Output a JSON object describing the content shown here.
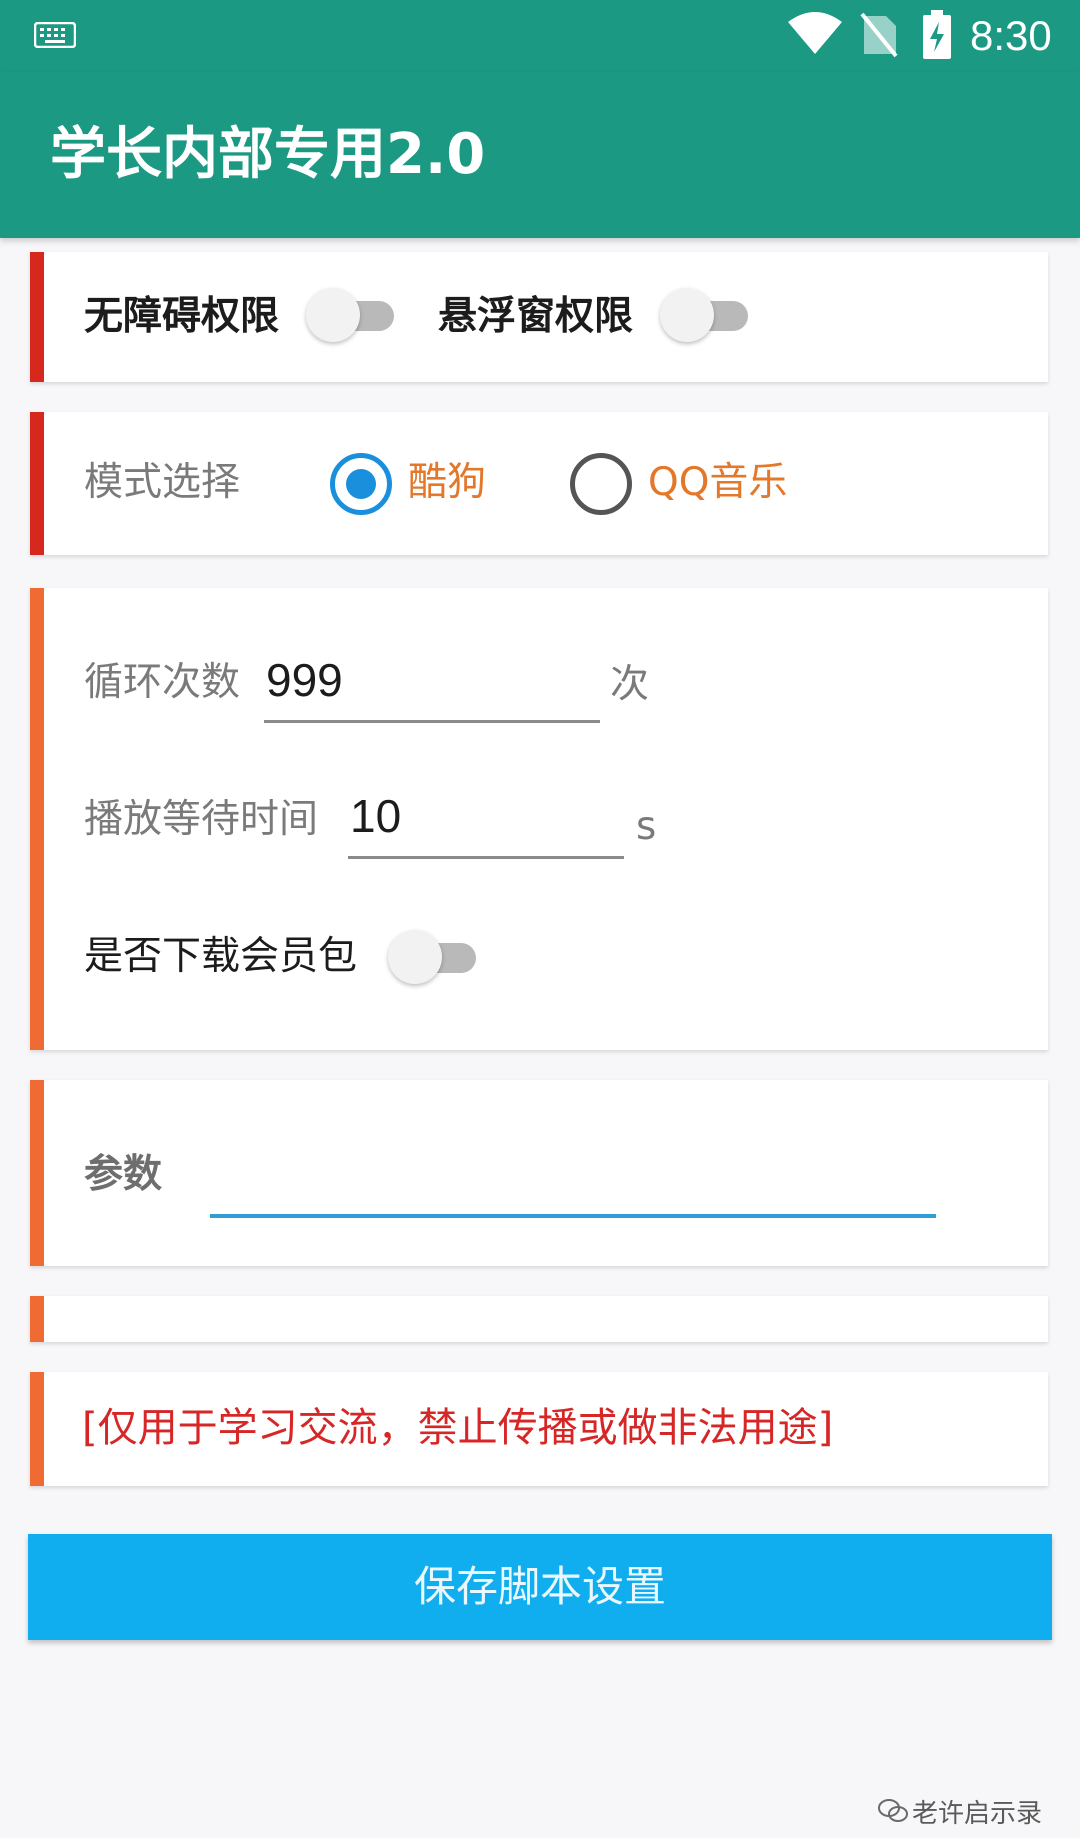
{
  "status_bar": {
    "time": "8:30",
    "icons": [
      "keyboard-icon",
      "wifi-icon",
      "no-sim-icon",
      "battery-charging-icon"
    ]
  },
  "app_bar": {
    "title": "学长内部专用2.0"
  },
  "permissions": {
    "accessibility_label": "无障碍权限",
    "accessibility_enabled": false,
    "overlay_label": "悬浮窗权限",
    "overlay_enabled": false
  },
  "mode": {
    "label": "模式选择",
    "options": [
      {
        "label": "酷狗",
        "selected": true
      },
      {
        "label": "QQ音乐",
        "selected": false
      }
    ]
  },
  "settings": {
    "loop_label": "循环次数",
    "loop_value": "999",
    "loop_unit": "次",
    "wait_label": "播放等待时间",
    "wait_value": "10",
    "wait_unit": "s",
    "download_label": "是否下载会员包",
    "download_enabled": false
  },
  "params": {
    "label": "参数",
    "value": ""
  },
  "notice": {
    "text": "[仅用于学习交流，禁止传播或做非法用途]"
  },
  "save_button": {
    "label": "保存脚本设置"
  },
  "watermark": {
    "text": "老许启示录"
  },
  "colors": {
    "app_bar": "#1c9983",
    "accent_red": "#d7281d",
    "accent_orange": "#f06a33",
    "radio_selected": "#1a8fdb",
    "option_text": "#e3772a",
    "notice_text": "#d62626",
    "button": "#11aeef"
  }
}
